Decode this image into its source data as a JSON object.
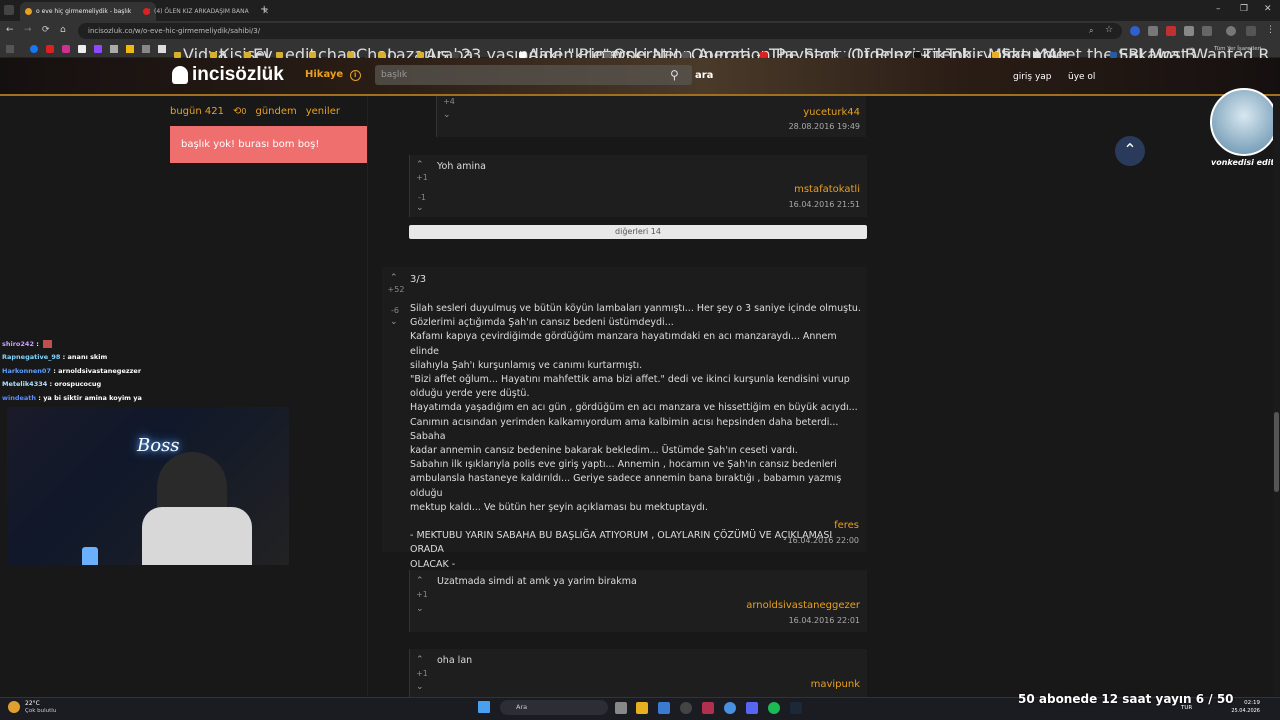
{
  "browser": {
    "tabs": [
      {
        "label": "o eve hiç girmemeliydik - başlık",
        "active": true
      },
      {
        "label": "(4) ÖLEN KIZ ARKADAŞIM BANA",
        "active": false
      }
    ],
    "new_tab": "+",
    "url": "incisozluk.co/w/o-eve-hic-girmemeliydik/sahibi/3/",
    "window_controls": [
      "–",
      "❐",
      "✕"
    ],
    "nav_buttons": [
      "←",
      "→",
      "⟳",
      "⌂"
    ],
    "bookmarks": [
      "Vidya",
      "Kişisel",
      "Ev",
      "edit",
      "chan",
      "Chao",
      "Lazarus",
      "Araba",
      "23 yaşındaki \"kripto...",
      "Aiden Pleterski Net...",
      "Operation Aurora -...",
      "Operation Payback...",
      "The Story Of Ponzi -...",
      "(1)geleceктenbiryolc...",
      "TikTok - Make Your...",
      "Satın Al",
      "Meet the Sakawa B...",
      "FBI Most Wanted R..."
    ],
    "bookmarks_more": "»",
    "all_bookmarks": "Tüm Yer İşaretleri"
  },
  "site": {
    "logo": "incisözlük",
    "hikaye": "Hikaye",
    "search_placeholder": "başlık",
    "search_button": "ara",
    "login": "giriş yap",
    "signup": "üye ol",
    "left_nav": {
      "bugun": "bugün 421",
      "count": "0",
      "gundem": "gündem",
      "yeniler": "yeniler"
    },
    "left_box": "başlık yok! burası bom boş!",
    "show_others": "diğerleri 14"
  },
  "entries": [
    {
      "id": "e0",
      "vote_up": "+4",
      "author": "yuceturk44",
      "date": "28.08.2016 19:49"
    },
    {
      "id": "e1",
      "text": "Yoh amina",
      "vote_up": "+1",
      "vote_down": "-1",
      "author": "mstafatokatli",
      "date": "16.04.2016 21:51"
    },
    {
      "id": "main",
      "heading": "3/3",
      "vote_up": "+52",
      "vote_down": "-6",
      "text": "Silah sesleri duyulmuş ve bütün köyün lambaları yanmıştı... Her şey o 3 saniye içinde olmuştu.\nGözlerimi açtığımda Şah'ın cansız bedeni üstümdeydi...\nKafamı kapıya çevirdiğimde gördüğüm manzara hayatımdaki en acı manzaraydı... Annem elinde\nsilahıyla Şah'ı kurşunlamış ve canımı kurtarmıştı.\n\"Bizi affet oğlum... Hayatını mahfettik ama bizi affet.\" dedi ve ikinci kurşunla kendisini vurup\nolduğu yerde yere düştü.\nHayatımda yaşadığım en acı gün , gördüğüm en acı manzara ve hissettiğim en büyük acıydı...\nCanımın acısından yerimden kalkamıyordum ama kalbimin acısı hepsinden daha beterdi... Sabaha\nkadar annemin cansız bedenine bakarak bekledim... Üstümde Şah'ın ceseti vardı.\nSabahın ilk ışıklarıyla polis eve giriş yaptı... Annemin , hocamın ve Şah'ın cansız bedenleri\nambulansla hastaneye kaldırıldı... Geriye sadece annemin bana bıraktığı , babamın yazmış olduğu\nmektup kaldı... Ve bütün her şeyin açıklaması bu mektuptaydı.\n\n- MEKTUBU YARIN SABAHA BU BAŞLIĞA ATIYORUM , OLAYLARIN ÇÖZÜMÜ VE AÇIKLAMASI ORADA\nOLACAK -",
      "author": "feres",
      "date": "16.04.2016 22:00"
    },
    {
      "id": "e3",
      "text": "Uzatmada simdi at amk ya yarim birakma",
      "vote_up": "+1",
      "author": "arnoldsivastaneggezer",
      "date": "16.04.2016 22:01"
    },
    {
      "id": "e4",
      "text": "oha lan",
      "vote_up": "+1",
      "author": "mavipunk"
    }
  ],
  "chat": [
    {
      "user": "shiro242",
      "msg": "",
      "color": "#c8a0ff"
    },
    {
      "user": "Rapnegative_98",
      "msg": "ananı skim",
      "color": "#7fd4ff"
    },
    {
      "user": "Harkonnen07",
      "msg": "arnoldsivastanegezzer",
      "color": "#5aa0ff"
    },
    {
      "user": "Metelik4334",
      "msg": "orospucocug",
      "color": "#b0e0ff"
    },
    {
      "user": "windeath",
      "msg": "ya bi siktir amina koyim ya",
      "color": "#5a8cff"
    }
  ],
  "webcam_sign": "Boss",
  "stream": {
    "avatar_name": "vonkedisi edit",
    "overlay": "50 abonede 12 saat yayın 6 / 50"
  },
  "taskbar": {
    "weather_temp": "22°C",
    "weather_desc": "Çok bulutlu",
    "search": "Ara",
    "lang": "TUR",
    "time": "02:19",
    "date": "25.04.2026"
  },
  "colors": {
    "accent": "#e8a020",
    "left_box": "#ef6f6f",
    "bg": "#181818"
  }
}
